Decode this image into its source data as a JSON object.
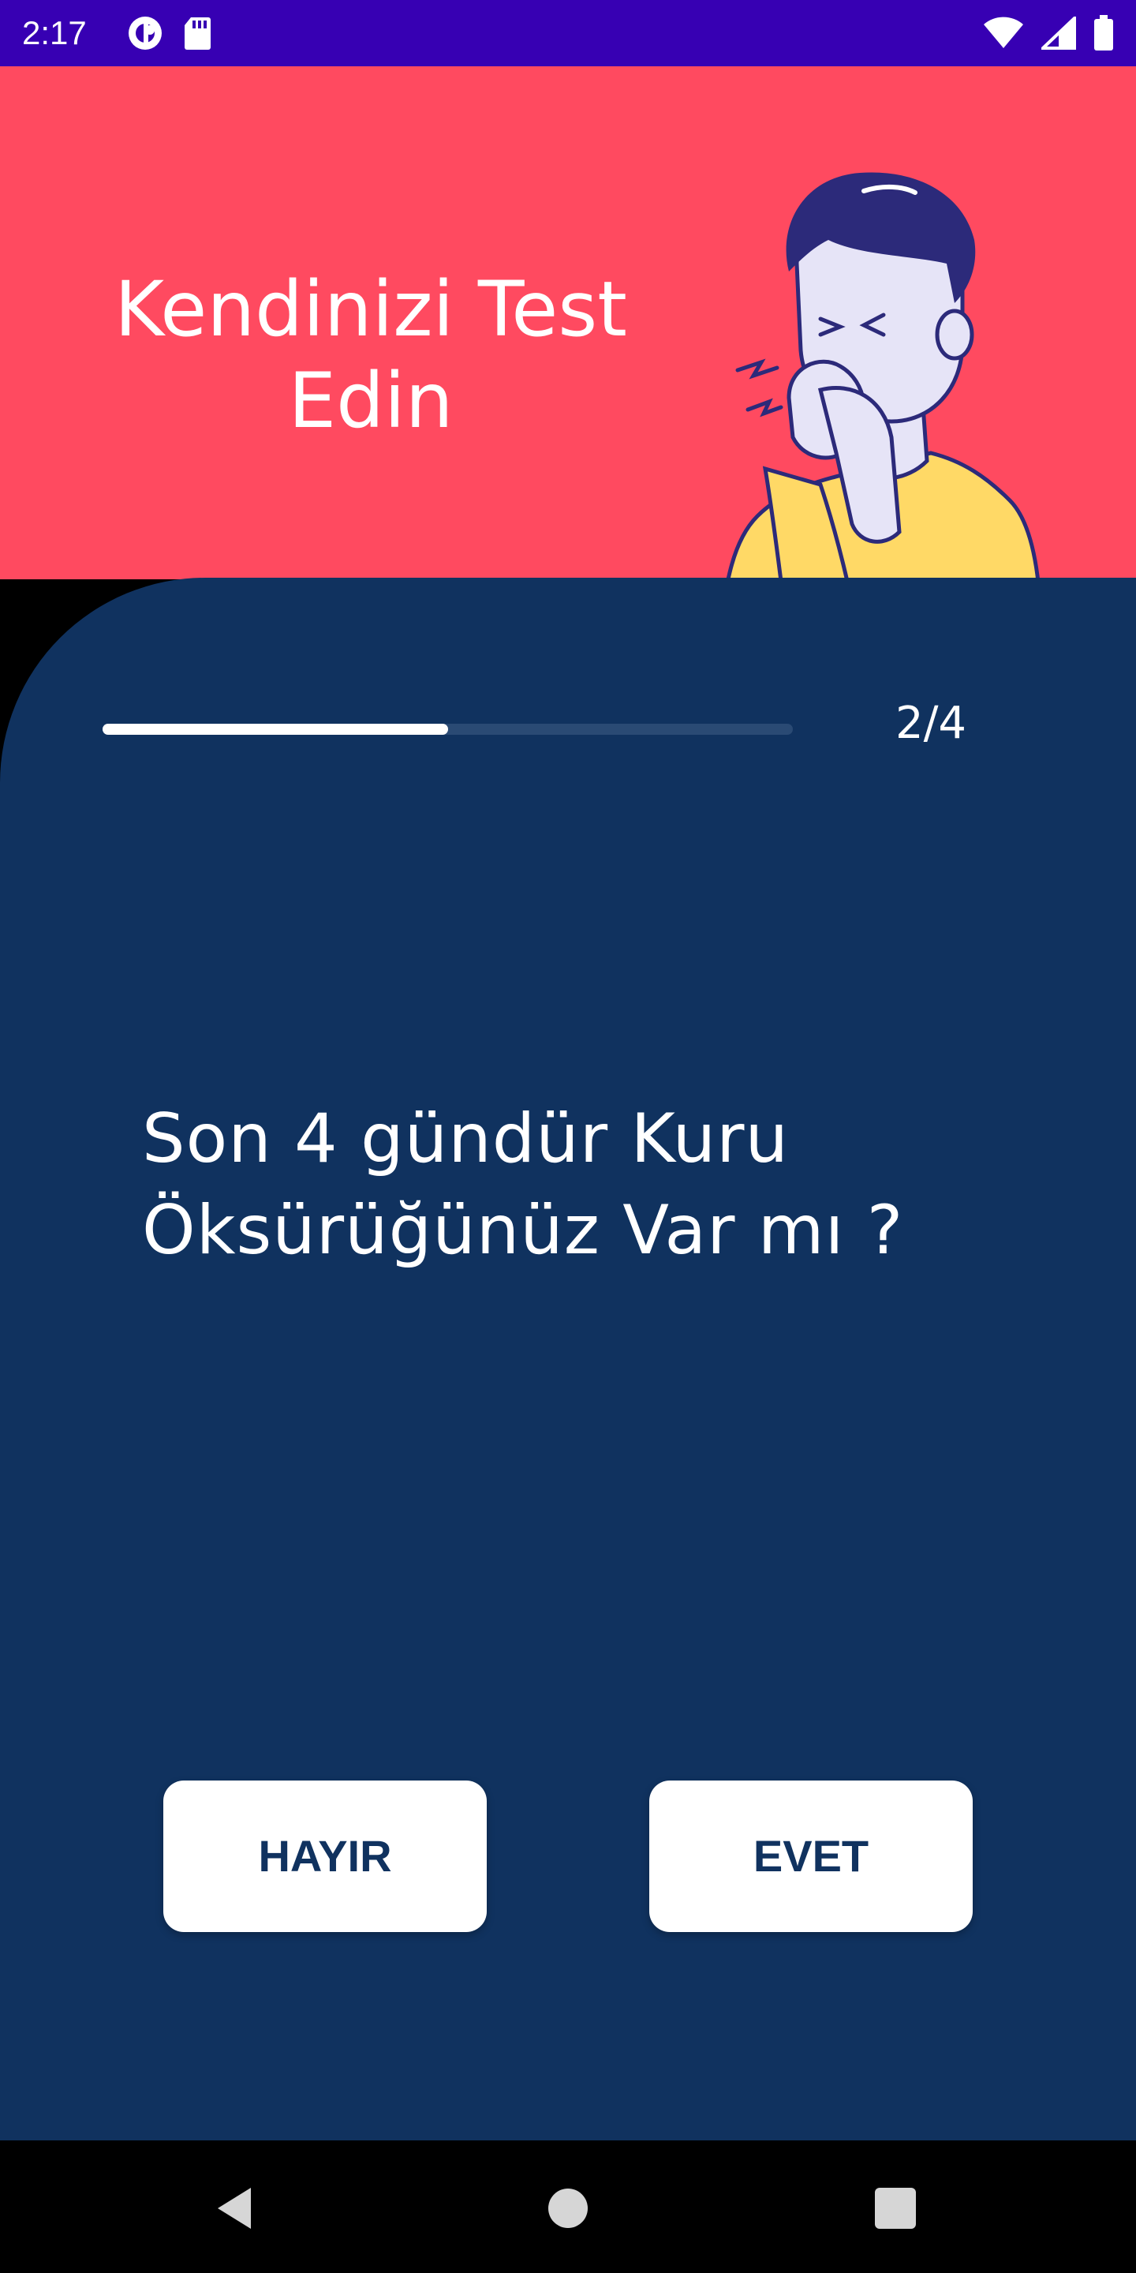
{
  "status_bar": {
    "time": "2:17",
    "icons_left": [
      "pocket-casts-icon",
      "sd-card-icon"
    ],
    "icons_right": [
      "wifi-icon",
      "cell-signal-icon",
      "battery-icon"
    ]
  },
  "header": {
    "title": "Kendinizi Test Edin",
    "illustration": "coughing-person-illustration"
  },
  "progress": {
    "label": "2/4",
    "current": 2,
    "total": 4,
    "fraction": 0.5
  },
  "question": {
    "text": "Son 4 gündür Kuru Öksürüğünüz Var mı ?"
  },
  "answers": {
    "no_label": "HAYIR",
    "yes_label": "EVET"
  },
  "nav_bar": {
    "icons": [
      "back-icon",
      "home-icon",
      "recents-icon"
    ]
  },
  "colors": {
    "status_bar": "#3700B3",
    "header_bg": "#FF4A60",
    "card_bg": "#10325F",
    "button_bg": "#FFFFFF",
    "button_text": "#10325F",
    "shirt": "#FFD966",
    "hair": "#2C2A7A"
  }
}
